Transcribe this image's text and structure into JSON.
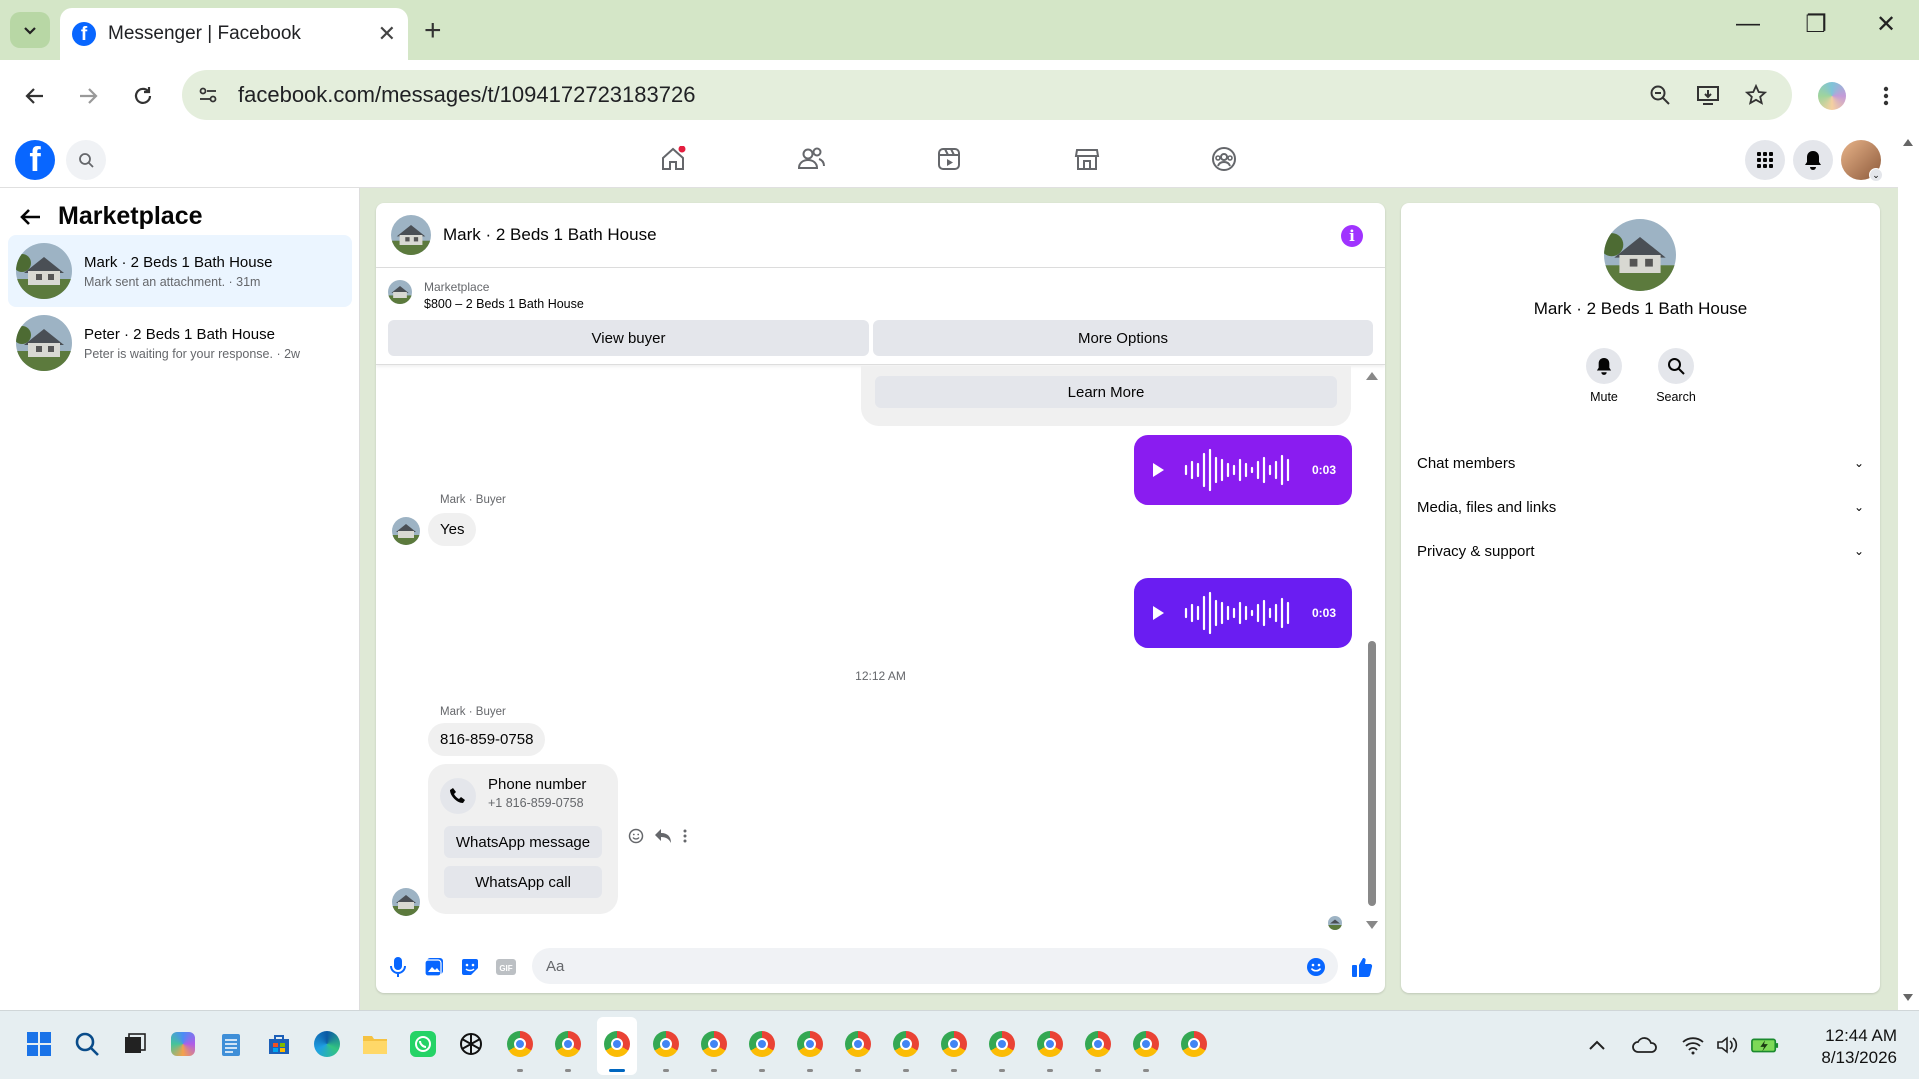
{
  "browser": {
    "tab_title": "Messenger | Facebook",
    "url": "facebook.com/messages/t/1094172723183726",
    "new_tab_label": "+"
  },
  "sidebar": {
    "title": "Marketplace",
    "conversations": [
      {
        "name": "Mark · 2 Beds 1 Bath House",
        "preview": "Mark sent an attachment. · 31m",
        "active": true
      },
      {
        "name": "Peter · 2 Beds 1 Bath House",
        "preview": "Peter is waiting for your response. · 2w",
        "active": false
      }
    ]
  },
  "chat": {
    "title": "Mark · 2 Beds 1 Bath House",
    "marketplace_label": "Marketplace",
    "listing": "$800 – 2 Beds 1 Bath House",
    "view_buyer": "View buyer",
    "more_options": "More Options",
    "learn_more": "Learn More",
    "voice_messages": [
      {
        "duration": "0:03"
      },
      {
        "duration": "0:03"
      }
    ],
    "sender_label_1": "Mark · Buyer",
    "message_yes": "Yes",
    "timestamp": "12:12 AM",
    "sender_label_2": "Mark · Buyer",
    "message_phone": "816-859-0758",
    "phone_card": {
      "title": "Phone number",
      "number": "+1 816-859-0758",
      "whatsapp_message": "WhatsApp message",
      "whatsapp_call": "WhatsApp call"
    },
    "composer_placeholder": "Aa",
    "voice_color": "#8a1cf0",
    "voice_color_2": "#6a1df2"
  },
  "info_panel": {
    "name": "Mark · 2 Beds 1 Bath House",
    "mute": "Mute",
    "search": "Search",
    "sections": [
      "Chat members",
      "Media, files and links",
      "Privacy & support"
    ]
  },
  "taskbar": {
    "time": "12:44 AM",
    "date": "8/13/2026"
  },
  "colors": {
    "fb_blue": "#0866ff",
    "messenger_purple": "#a033ff"
  }
}
